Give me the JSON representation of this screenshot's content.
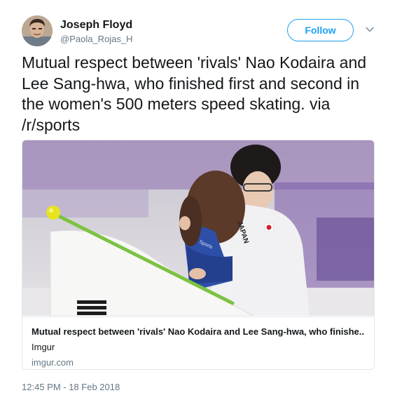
{
  "author": {
    "display_name": "Joseph Floyd",
    "handle": "@Paola_Rojas_H",
    "avatar_icon": "profile-photo"
  },
  "actions": {
    "follow_label": "Follow",
    "more_icon": "chevron-down-icon"
  },
  "tweet": {
    "text": "Mutual respect between 'rivals' Nao Kodaira and Lee Sang-hwa, who finished first and second in the women's 500 meters speed skating. via /r/sports",
    "timestamp": "12:45 PM - 18 Feb 2018"
  },
  "card": {
    "title": "Mutual respect between 'rivals' Nao Kodaira and Lee Sang-hwa, who finishe...",
    "description": "Imgur",
    "domain": "imgur.com",
    "image": {
      "jacket_print": "JAPAN",
      "suit_print": "Sports"
    }
  },
  "colors": {
    "accent": "#1da1f2",
    "text": "#14171a",
    "secondary_text": "#657786",
    "border": "#e1e8ed"
  }
}
